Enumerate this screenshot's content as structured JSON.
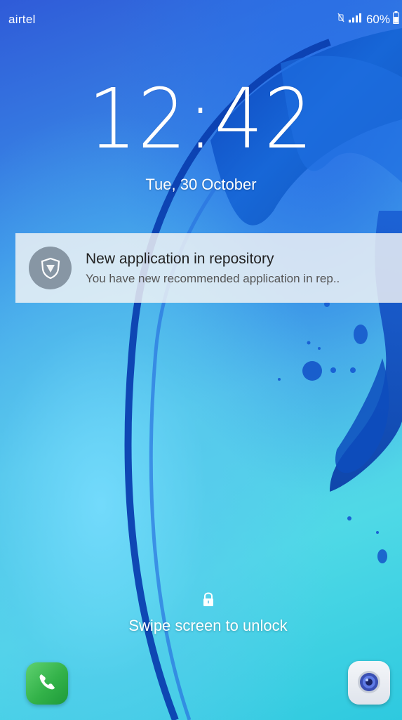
{
  "status_bar": {
    "carrier": "airtel",
    "battery": "60%",
    "icons": [
      "mute-icon",
      "signal-icon",
      "battery-icon"
    ]
  },
  "lockscreen": {
    "time": "12:42",
    "date": "Tue, 30 October",
    "unlock_hint": "Swipe screen to unlock"
  },
  "notification": {
    "icon": "shield-icon",
    "title": "New application in repository",
    "body": "You have new recommended application in rep.."
  },
  "shortcuts": {
    "left": "phone-icon",
    "right": "camera-icon"
  },
  "colors": {
    "notification_bg": "#f5f5f5",
    "notif_icon_bg": "#8796a4",
    "phone_green": "#33b249"
  }
}
